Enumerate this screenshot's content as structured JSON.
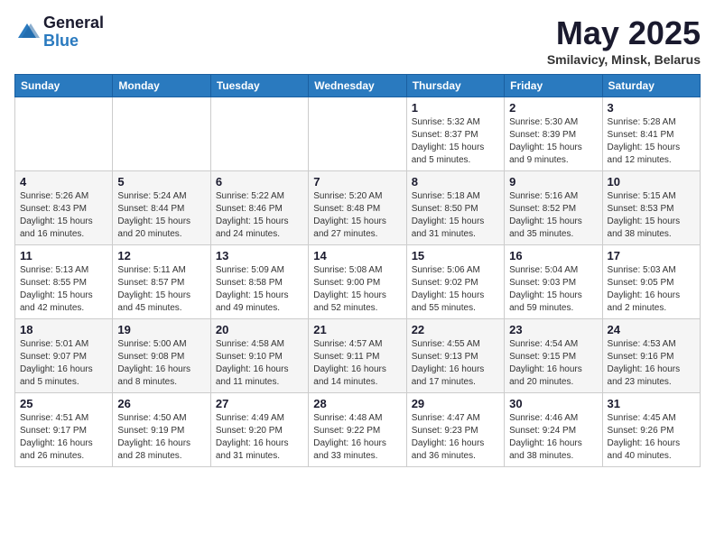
{
  "logo": {
    "general": "General",
    "blue": "Blue"
  },
  "title": "May 2025",
  "location": "Smilavicy, Minsk, Belarus",
  "weekdays": [
    "Sunday",
    "Monday",
    "Tuesday",
    "Wednesday",
    "Thursday",
    "Friday",
    "Saturday"
  ],
  "weeks": [
    [
      {
        "day": "",
        "info": ""
      },
      {
        "day": "",
        "info": ""
      },
      {
        "day": "",
        "info": ""
      },
      {
        "day": "",
        "info": ""
      },
      {
        "day": "1",
        "info": "Sunrise: 5:32 AM\nSunset: 8:37 PM\nDaylight: 15 hours\nand 5 minutes."
      },
      {
        "day": "2",
        "info": "Sunrise: 5:30 AM\nSunset: 8:39 PM\nDaylight: 15 hours\nand 9 minutes."
      },
      {
        "day": "3",
        "info": "Sunrise: 5:28 AM\nSunset: 8:41 PM\nDaylight: 15 hours\nand 12 minutes."
      }
    ],
    [
      {
        "day": "4",
        "info": "Sunrise: 5:26 AM\nSunset: 8:43 PM\nDaylight: 15 hours\nand 16 minutes."
      },
      {
        "day": "5",
        "info": "Sunrise: 5:24 AM\nSunset: 8:44 PM\nDaylight: 15 hours\nand 20 minutes."
      },
      {
        "day": "6",
        "info": "Sunrise: 5:22 AM\nSunset: 8:46 PM\nDaylight: 15 hours\nand 24 minutes."
      },
      {
        "day": "7",
        "info": "Sunrise: 5:20 AM\nSunset: 8:48 PM\nDaylight: 15 hours\nand 27 minutes."
      },
      {
        "day": "8",
        "info": "Sunrise: 5:18 AM\nSunset: 8:50 PM\nDaylight: 15 hours\nand 31 minutes."
      },
      {
        "day": "9",
        "info": "Sunrise: 5:16 AM\nSunset: 8:52 PM\nDaylight: 15 hours\nand 35 minutes."
      },
      {
        "day": "10",
        "info": "Sunrise: 5:15 AM\nSunset: 8:53 PM\nDaylight: 15 hours\nand 38 minutes."
      }
    ],
    [
      {
        "day": "11",
        "info": "Sunrise: 5:13 AM\nSunset: 8:55 PM\nDaylight: 15 hours\nand 42 minutes."
      },
      {
        "day": "12",
        "info": "Sunrise: 5:11 AM\nSunset: 8:57 PM\nDaylight: 15 hours\nand 45 minutes."
      },
      {
        "day": "13",
        "info": "Sunrise: 5:09 AM\nSunset: 8:58 PM\nDaylight: 15 hours\nand 49 minutes."
      },
      {
        "day": "14",
        "info": "Sunrise: 5:08 AM\nSunset: 9:00 PM\nDaylight: 15 hours\nand 52 minutes."
      },
      {
        "day": "15",
        "info": "Sunrise: 5:06 AM\nSunset: 9:02 PM\nDaylight: 15 hours\nand 55 minutes."
      },
      {
        "day": "16",
        "info": "Sunrise: 5:04 AM\nSunset: 9:03 PM\nDaylight: 15 hours\nand 59 minutes."
      },
      {
        "day": "17",
        "info": "Sunrise: 5:03 AM\nSunset: 9:05 PM\nDaylight: 16 hours\nand 2 minutes."
      }
    ],
    [
      {
        "day": "18",
        "info": "Sunrise: 5:01 AM\nSunset: 9:07 PM\nDaylight: 16 hours\nand 5 minutes."
      },
      {
        "day": "19",
        "info": "Sunrise: 5:00 AM\nSunset: 9:08 PM\nDaylight: 16 hours\nand 8 minutes."
      },
      {
        "day": "20",
        "info": "Sunrise: 4:58 AM\nSunset: 9:10 PM\nDaylight: 16 hours\nand 11 minutes."
      },
      {
        "day": "21",
        "info": "Sunrise: 4:57 AM\nSunset: 9:11 PM\nDaylight: 16 hours\nand 14 minutes."
      },
      {
        "day": "22",
        "info": "Sunrise: 4:55 AM\nSunset: 9:13 PM\nDaylight: 16 hours\nand 17 minutes."
      },
      {
        "day": "23",
        "info": "Sunrise: 4:54 AM\nSunset: 9:15 PM\nDaylight: 16 hours\nand 20 minutes."
      },
      {
        "day": "24",
        "info": "Sunrise: 4:53 AM\nSunset: 9:16 PM\nDaylight: 16 hours\nand 23 minutes."
      }
    ],
    [
      {
        "day": "25",
        "info": "Sunrise: 4:51 AM\nSunset: 9:17 PM\nDaylight: 16 hours\nand 26 minutes."
      },
      {
        "day": "26",
        "info": "Sunrise: 4:50 AM\nSunset: 9:19 PM\nDaylight: 16 hours\nand 28 minutes."
      },
      {
        "day": "27",
        "info": "Sunrise: 4:49 AM\nSunset: 9:20 PM\nDaylight: 16 hours\nand 31 minutes."
      },
      {
        "day": "28",
        "info": "Sunrise: 4:48 AM\nSunset: 9:22 PM\nDaylight: 16 hours\nand 33 minutes."
      },
      {
        "day": "29",
        "info": "Sunrise: 4:47 AM\nSunset: 9:23 PM\nDaylight: 16 hours\nand 36 minutes."
      },
      {
        "day": "30",
        "info": "Sunrise: 4:46 AM\nSunset: 9:24 PM\nDaylight: 16 hours\nand 38 minutes."
      },
      {
        "day": "31",
        "info": "Sunrise: 4:45 AM\nSunset: 9:26 PM\nDaylight: 16 hours\nand 40 minutes."
      }
    ]
  ]
}
